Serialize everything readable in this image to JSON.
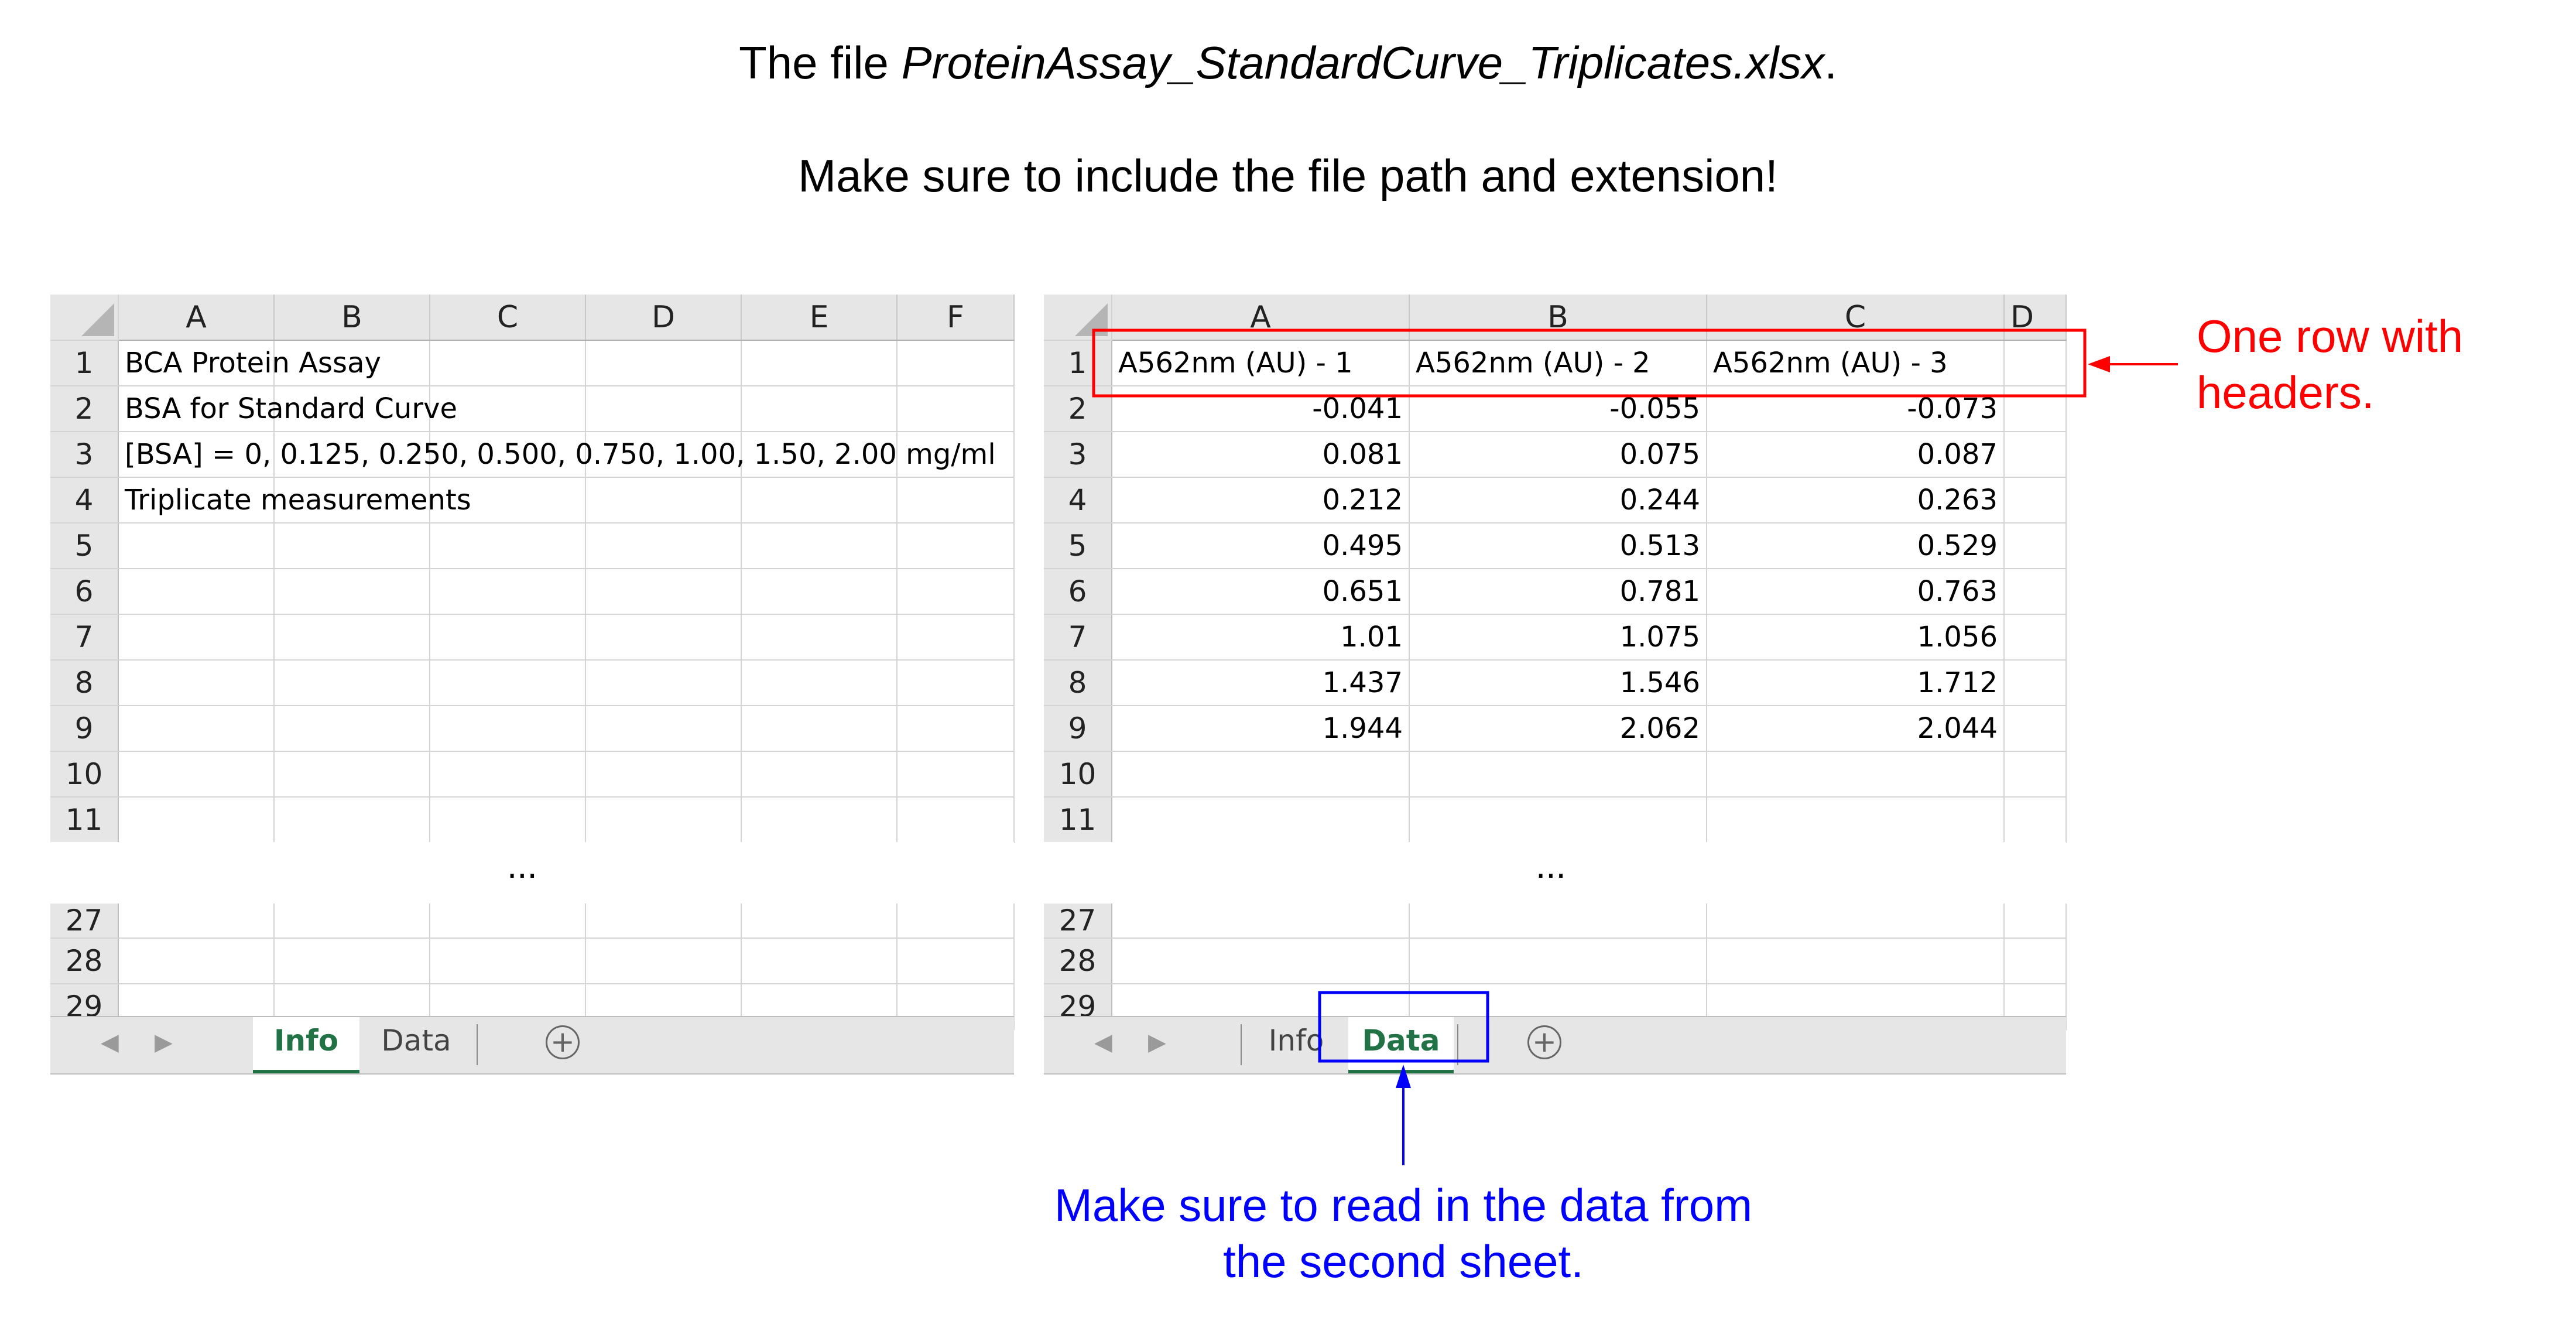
{
  "heading": {
    "line1_prefix": "The file ",
    "line1_filename": "ProteinAssay_StandardCurve_Triplicates.xlsx",
    "line1_suffix": ".",
    "line2": "Make sure to include the file path and extension!"
  },
  "left_sheet": {
    "columns": [
      "A",
      "B",
      "C",
      "D",
      "E",
      "F"
    ],
    "rows": [
      {
        "num": "1",
        "text": "BCA Protein Assay"
      },
      {
        "num": "2",
        "text": "BSA for Standard Curve"
      },
      {
        "num": "3",
        "text": "[BSA] = 0, 0.125, 0.250, 0.500, 0.750, 1.00, 1.50, 2.00 mg/ml"
      },
      {
        "num": "4",
        "text": "Triplicate measurements"
      },
      {
        "num": "5",
        "text": ""
      },
      {
        "num": "6",
        "text": ""
      },
      {
        "num": "7",
        "text": ""
      },
      {
        "num": "8",
        "text": ""
      },
      {
        "num": "9",
        "text": ""
      },
      {
        "num": "10",
        "text": ""
      },
      {
        "num": "11",
        "text": ""
      }
    ],
    "tail_rows": [
      "27",
      "28",
      "29"
    ],
    "ellipsis": "...",
    "tabs": {
      "sheet1": "Info",
      "sheet2": "Data",
      "active": "Info"
    }
  },
  "right_sheet": {
    "columns": [
      "A",
      "B",
      "C",
      "D"
    ],
    "headers": [
      "A562nm (AU) - 1",
      "A562nm (AU) - 2",
      "A562nm (AU) - 3"
    ],
    "rows": [
      {
        "num": "2",
        "values": [
          "-0.041",
          "-0.055",
          "-0.073"
        ]
      },
      {
        "num": "3",
        "values": [
          "0.081",
          "0.075",
          "0.087"
        ]
      },
      {
        "num": "4",
        "values": [
          "0.212",
          "0.244",
          "0.263"
        ]
      },
      {
        "num": "5",
        "values": [
          "0.495",
          "0.513",
          "0.529"
        ]
      },
      {
        "num": "6",
        "values": [
          "0.651",
          "0.781",
          "0.763"
        ]
      },
      {
        "num": "7",
        "values": [
          "1.01",
          "1.075",
          "1.056"
        ]
      },
      {
        "num": "8",
        "values": [
          "1.437",
          "1.546",
          "1.712"
        ]
      },
      {
        "num": "9",
        "values": [
          "1.944",
          "2.062",
          "2.044"
        ]
      },
      {
        "num": "10",
        "values": [
          "",
          "",
          ""
        ]
      },
      {
        "num": "11",
        "values": [
          "",
          "",
          ""
        ]
      }
    ],
    "tail_rows": [
      "27",
      "28",
      "29"
    ],
    "ellipsis": "...",
    "tabs": {
      "sheet1": "Info",
      "sheet2": "Data",
      "active": "Data"
    }
  },
  "annotations": {
    "headers_note": "One row with headers.",
    "headers_note_line1": "One row with",
    "headers_note_line2": "headers.",
    "sheet_note_line1": "Make sure to read in the data from",
    "sheet_note_line2": "the second sheet.",
    "red_color": "#ff0000",
    "blue_color": "#0000ff"
  },
  "ui": {
    "excel_green": "#217346",
    "icons": [
      "nav-left-icon",
      "nav-right-icon",
      "add-sheet-icon"
    ]
  }
}
